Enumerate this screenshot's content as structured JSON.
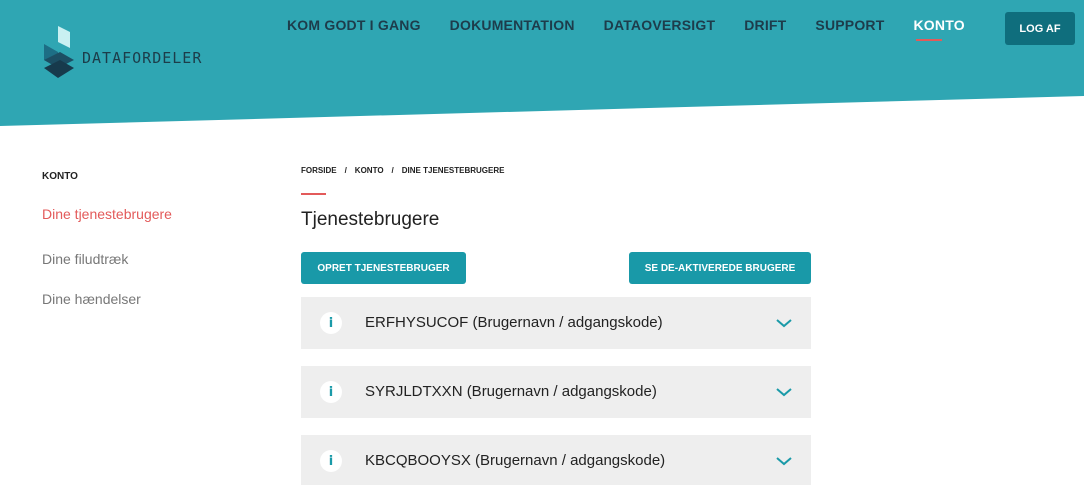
{
  "brand": {
    "name": "DATAFORDELER"
  },
  "colors": {
    "header": "#2fa6b3",
    "accent": "#e35a5a",
    "button": "#1999a8",
    "logout": "#0f6e7d"
  },
  "nav": {
    "items": [
      {
        "label": "KOM GODT I GANG",
        "active": false
      },
      {
        "label": "DOKUMENTATION",
        "active": false
      },
      {
        "label": "DATAOVERSIGT",
        "active": false
      },
      {
        "label": "DRIFT",
        "active": false
      },
      {
        "label": "SUPPORT",
        "active": false
      },
      {
        "label": "KONTO",
        "active": true
      }
    ],
    "logout_label": "LOG AF"
  },
  "sidebar": {
    "title": "KONTO",
    "items": [
      {
        "label": "Dine tjenestebrugere",
        "active": true
      },
      {
        "label": "Dine filudtræk",
        "active": false
      },
      {
        "label": "Dine hændelser",
        "active": false
      }
    ]
  },
  "breadcrumb": {
    "items": [
      "FORSIDE",
      "KONTO",
      "DINE TJENESTEBRUGERE"
    ],
    "separator": "/"
  },
  "main": {
    "title": "Tjenestebrugere",
    "create_button": "OPRET TJENESTEBRUGER",
    "deactivated_button": "SE DE-AKTIVEREDE BRUGERE",
    "users": [
      {
        "label": "ERFHYSUCOF (Brugernavn / adgangskode)",
        "info_icon": "i"
      },
      {
        "label": "SYRJLDTXXN (Brugernavn / adgangskode)",
        "info_icon": "i"
      },
      {
        "label": "KBCQBOOYSX (Brugernavn / adgangskode)",
        "info_icon": "i"
      }
    ]
  }
}
